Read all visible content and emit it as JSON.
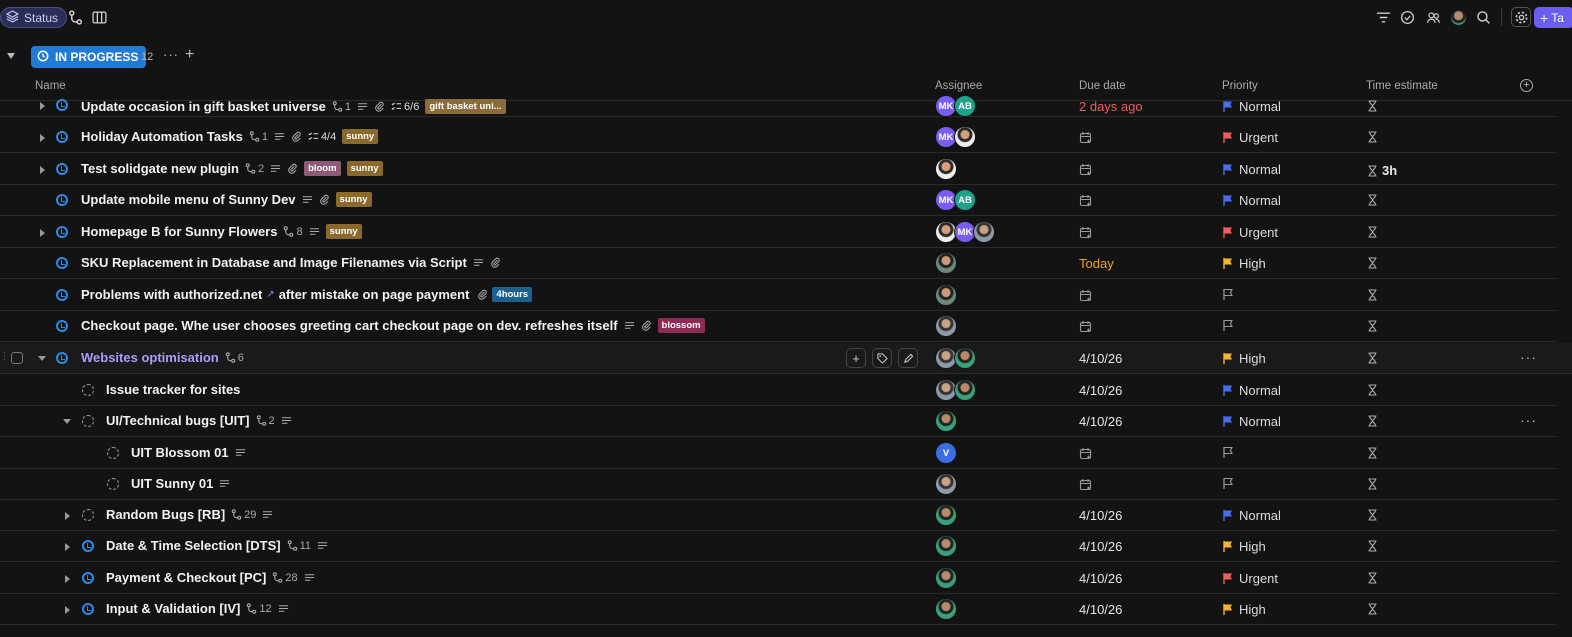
{
  "toolbar": {
    "status_label": "Status",
    "add_task_label": "Ta"
  },
  "group": {
    "label": "IN PROGRESS",
    "count": "12"
  },
  "columns": {
    "name": "Name",
    "assignee": "Assignee",
    "due": "Due date",
    "priority": "Priority",
    "time": "Time estimate"
  },
  "colors": {
    "urgent": "#f25c5c",
    "high": "#f5b62b",
    "normal": "#4a6cf0",
    "none": "#9a9a9a",
    "accent": "#6b5cf2"
  },
  "rows": [
    {
      "name": "Update occasion in gift basket universe",
      "subtasks": "1",
      "checklist": "6/6",
      "tags": [
        {
          "text": "gift basket uni...",
          "color": "#8a6b3a"
        }
      ],
      "due": "2 days ago",
      "priority": "Normal",
      "time": ""
    },
    {
      "name": "Holiday Automation Tasks",
      "subtasks": "1",
      "checklist": "4/4",
      "tags": [
        {
          "text": "sunny",
          "color": "#8a6a2a"
        }
      ],
      "due": "",
      "priority": "Urgent",
      "time": ""
    },
    {
      "name": "Test solidgate new plugin",
      "subtasks": "2",
      "tags": [
        {
          "text": "bloom",
          "color": "#8e5a78"
        },
        {
          "text": "sunny",
          "color": "#8a6a2a"
        }
      ],
      "due": "",
      "priority": "Normal",
      "time": "3h"
    },
    {
      "name": "Update mobile menu of Sunny Dev",
      "tags": [
        {
          "text": "sunny",
          "color": "#8a6a2a"
        }
      ],
      "due": "",
      "priority": "Normal",
      "time": ""
    },
    {
      "name": "Homepage B for Sunny Flowers",
      "subtasks": "8",
      "tags": [
        {
          "text": "sunny",
          "color": "#8a6a2a"
        }
      ],
      "due": "",
      "priority": "Urgent",
      "time": ""
    },
    {
      "name": "SKU Replacement in Database and Image Filenames via Script",
      "due": "Today",
      "priority": "High",
      "time": ""
    },
    {
      "name": "Problems with authorized.net",
      "name_tail": "after mistake on page payment",
      "tags": [
        {
          "text": "4hours",
          "color": "#1e5f92"
        }
      ],
      "due": "",
      "priority": "",
      "time": ""
    },
    {
      "name": "Checkout page. Whe user chooses greeting cart checkout page on dev. refreshes itself",
      "tags": [
        {
          "text": "blossom",
          "color": "#8e2a55"
        }
      ],
      "due": "",
      "priority": "",
      "time": ""
    },
    {
      "name": "Websites optimisation",
      "subtasks": "6",
      "due": "4/10/26",
      "priority": "High",
      "time": ""
    },
    {
      "name": "Issue tracker for sites",
      "due": "4/10/26",
      "priority": "Normal",
      "time": ""
    },
    {
      "name": "UI/Technical bugs [UIT]",
      "subtasks": "2",
      "due": "4/10/26",
      "priority": "Normal",
      "time": ""
    },
    {
      "name": "UIT Blossom 01",
      "due": "",
      "priority": "",
      "time": "",
      "assignee_initial": "V"
    },
    {
      "name": "UIT Sunny 01",
      "due": "",
      "priority": "",
      "time": ""
    },
    {
      "name": "Random Bugs [RB]",
      "subtasks": "29",
      "due": "4/10/26",
      "priority": "Normal",
      "time": ""
    },
    {
      "name": "Date & Time Selection [DTS]",
      "subtasks": "11",
      "due": "4/10/26",
      "priority": "High",
      "time": ""
    },
    {
      "name": "Payment & Checkout [PC]",
      "subtasks": "28",
      "due": "4/10/26",
      "priority": "Urgent",
      "time": ""
    },
    {
      "name": "Input & Validation [IV]",
      "subtasks": "12",
      "due": "4/10/26",
      "priority": "High",
      "time": ""
    }
  ],
  "avatars": {
    "mk": "MK",
    "ab": "AB"
  }
}
